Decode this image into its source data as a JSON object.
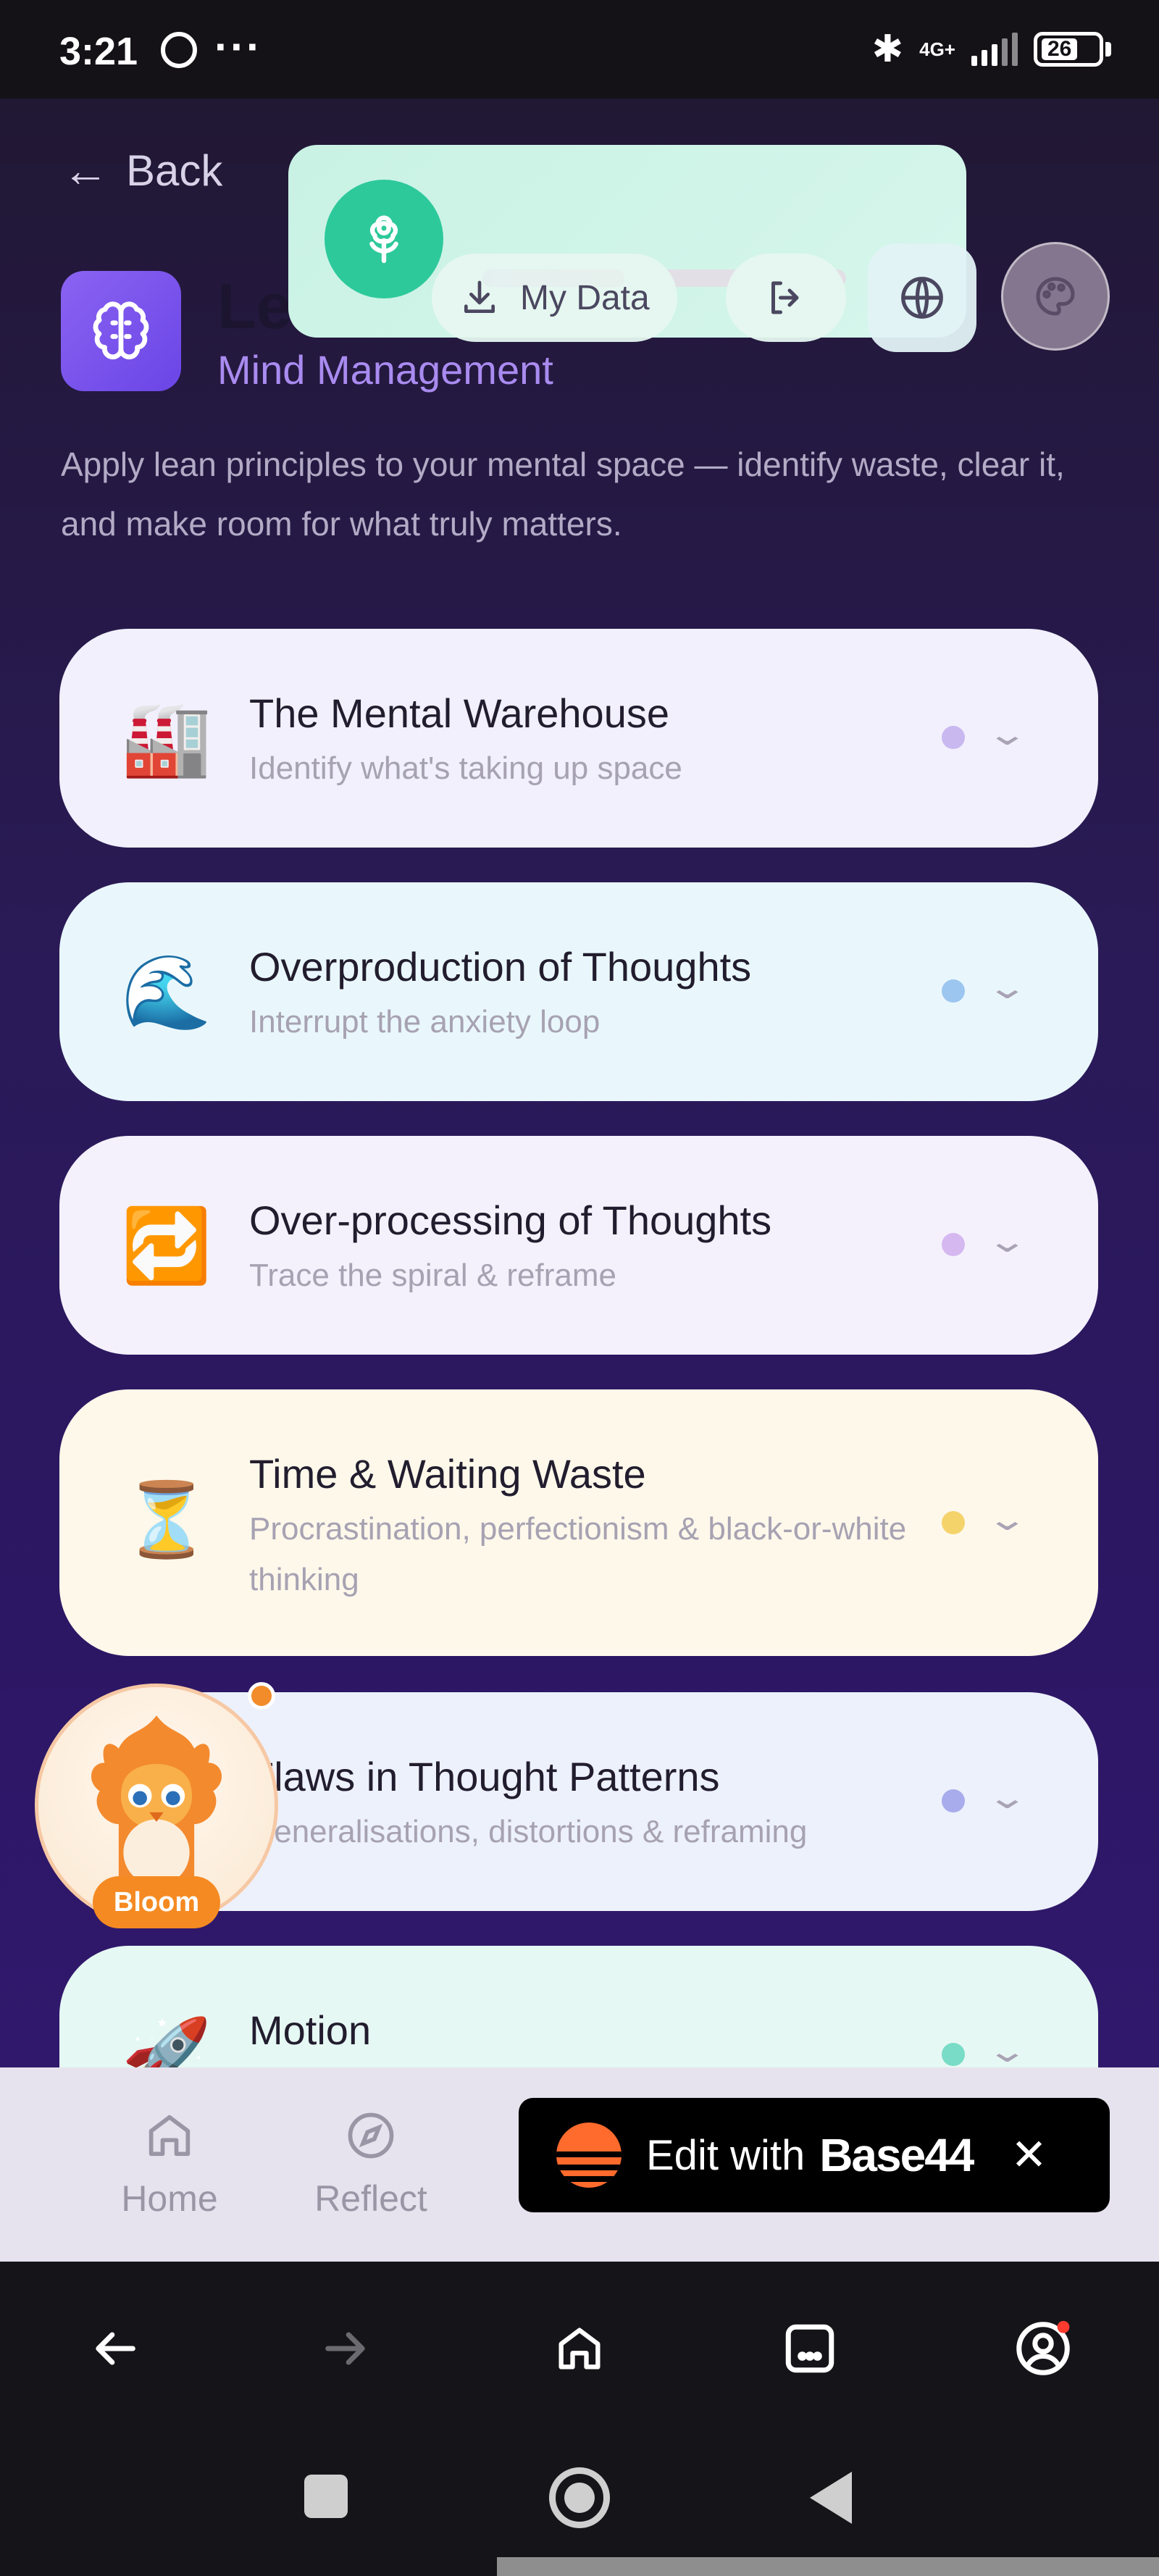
{
  "status_bar": {
    "time": "3:21",
    "network": "4G+",
    "battery": "26"
  },
  "header": {
    "back_label": "Back",
    "title": "Le",
    "subtitle": "Mind Management",
    "description": "Apply lean principles to your mental space — identify waste, clear it, and make room for what truly matters."
  },
  "toolbar": {
    "my_data_label": "My Data",
    "progress_fraction": 0.39
  },
  "modules": [
    {
      "emoji": "🏭",
      "title": "The Mental Warehouse",
      "subtitle": "Identify what's taking up space",
      "bg": "#f1f0fc",
      "dot": "#c9b8f0"
    },
    {
      "emoji": "🌊",
      "title": "Overproduction of Thoughts",
      "subtitle": "Interrupt the anxiety loop",
      "bg": "#e9f7fc",
      "dot": "#9cc6f0"
    },
    {
      "emoji": "🔁",
      "title": "Over-processing of Thoughts",
      "subtitle": "Trace the spiral & reframe",
      "bg": "#f4f1fc",
      "dot": "#d6b8f0"
    },
    {
      "emoji": "⏳",
      "title": "Time & Waiting Waste",
      "subtitle": "Procrastination, perfectionism & black-or-white thinking",
      "bg": "#fdf8ea",
      "dot": "#f5d36b"
    },
    {
      "emoji": "",
      "title": "Flaws in Thought Patterns",
      "subtitle": "Generalisations, distortions & reframing",
      "bg": "#edf1fc",
      "dot": "#a8acec"
    },
    {
      "emoji": "🚀",
      "title": "Motion",
      "subtitle": "",
      "bg": "#e6f8f3",
      "dot": "#79dcc6"
    }
  ],
  "mascot": {
    "label": "Bloom"
  },
  "app_nav": {
    "items": [
      {
        "label": "Home",
        "icon": "home-icon"
      },
      {
        "label": "Reflect",
        "icon": "compass-icon"
      }
    ]
  },
  "base44_banner": {
    "edit_label": "Edit with",
    "brand": "Base44",
    "close": "✕"
  },
  "browser_nav": {
    "icons": [
      "back-arrow-icon",
      "forward-arrow-icon",
      "home-icon",
      "tabs-icon",
      "profile-icon"
    ]
  }
}
